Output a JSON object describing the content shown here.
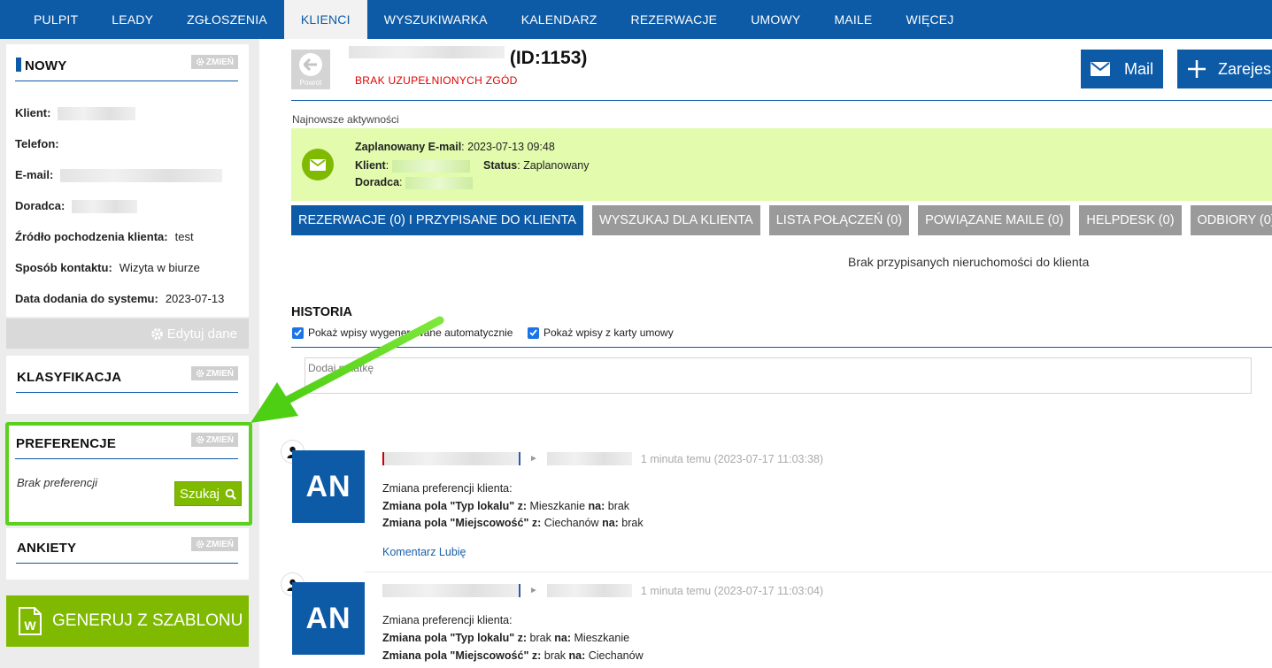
{
  "nav": {
    "items": [
      "PULPIT",
      "LEADY",
      "ZGŁOSZENIA",
      "KLIENCI",
      "WYSZUKIWARKA",
      "KALENDARZ",
      "REZERWACJE",
      "UMOWY",
      "MAILE",
      "WIĘCEJ"
    ],
    "active_index": 3
  },
  "sidebar": {
    "status_panel": {
      "title": "NOWY",
      "change_label": "ZMIEŃ",
      "rows": {
        "client_label": "Klient:",
        "phone_label": "Telefon:",
        "email_label": "E-mail:",
        "advisor_label": "Doradca:",
        "source_label": "Źródło pochodzenia klienta:",
        "source_value": "test",
        "contact_label": "Sposób kontaktu:",
        "contact_value": "Wizyta w biurze",
        "added_label": "Data dodania do systemu:",
        "added_value": "2023-07-13"
      },
      "edit_label": "Edytuj dane"
    },
    "classification": {
      "title": "KLASYFIKACJA",
      "change_label": "ZMIEŃ"
    },
    "preferences": {
      "title": "PREFERENCJE",
      "change_label": "ZMIEŃ",
      "empty_text": "Brak preferencji",
      "search_label": "Szukaj"
    },
    "surveys": {
      "title": "ANKIETY",
      "change_label": "ZMIEŃ"
    },
    "generate_label": "GENERUJ Z SZABLONU"
  },
  "header": {
    "back_label": "Powrót",
    "client_id": "(ID:1153)",
    "consent_warning": "BRAK UZUPEŁNIONYCH ZGÓD",
    "mail_label": "Mail",
    "register_label": "Zarejes"
  },
  "latest": {
    "label": "Najnowsze aktywności",
    "email_label": "Zaplanowany E-mail",
    "email_date": ": 2023-07-13 09:48",
    "client_label": "Klient",
    "status_label": "Status",
    "status_value": ": Zaplanowany",
    "advisor_label": "Doradca"
  },
  "tabs": [
    "REZERWACJE (0) I PRZYPISANE DO KLIENTA",
    "WYSZUKAJ DLA KLIENTA",
    "LISTA POŁĄCZEŃ (0)",
    "POWIĄZANE MAILE (0)",
    "HELPDESK (0)",
    "ODBIORY (0)"
  ],
  "no_properties": "Brak przypisanych nieruchomości do klienta",
  "history": {
    "title": "HISTORIA",
    "check_auto": "Pokaż wpisy wygenerowane automatycznie",
    "check_contract": "Pokaż wpisy z karty umowy",
    "note_placeholder": "Dodaj notatkę",
    "entries": [
      {
        "avatar": "AN",
        "time": "1 minuta temu (2023-07-17 11:03:38)",
        "intro": "Zmiana preferencji klienta:",
        "l1_field": "Zmiana pola \"Typ lokalu\" z:",
        "l1_from": " Mieszkanie ",
        "l1_to_label": "na:",
        "l1_to": " brak",
        "l2_field": "Zmiana pola \"Miejscowość\" z:",
        "l2_from": " Ciechanów ",
        "l2_to_label": "na:",
        "l2_to": " brak",
        "actions": "Komentarz Lubię"
      },
      {
        "avatar": "AN",
        "time": "1 minuta temu (2023-07-17 11:03:04)",
        "intro": "Zmiana preferencji klienta:",
        "l1_field": "Zmiana pola \"Typ lokalu\" z:",
        "l1_from": " brak ",
        "l1_to_label": "na:",
        "l1_to": " Mieszkanie",
        "l2_field": "Zmiana pola \"Miejscowość\" z:",
        "l2_from": " brak ",
        "l2_to_label": "na:",
        "l2_to": " Ciechanów"
      }
    ]
  },
  "colors": {
    "brand": "#0d5aa7",
    "accent_green": "#7fba00",
    "highlight": "#5bd01e",
    "warning": "#e00000"
  }
}
